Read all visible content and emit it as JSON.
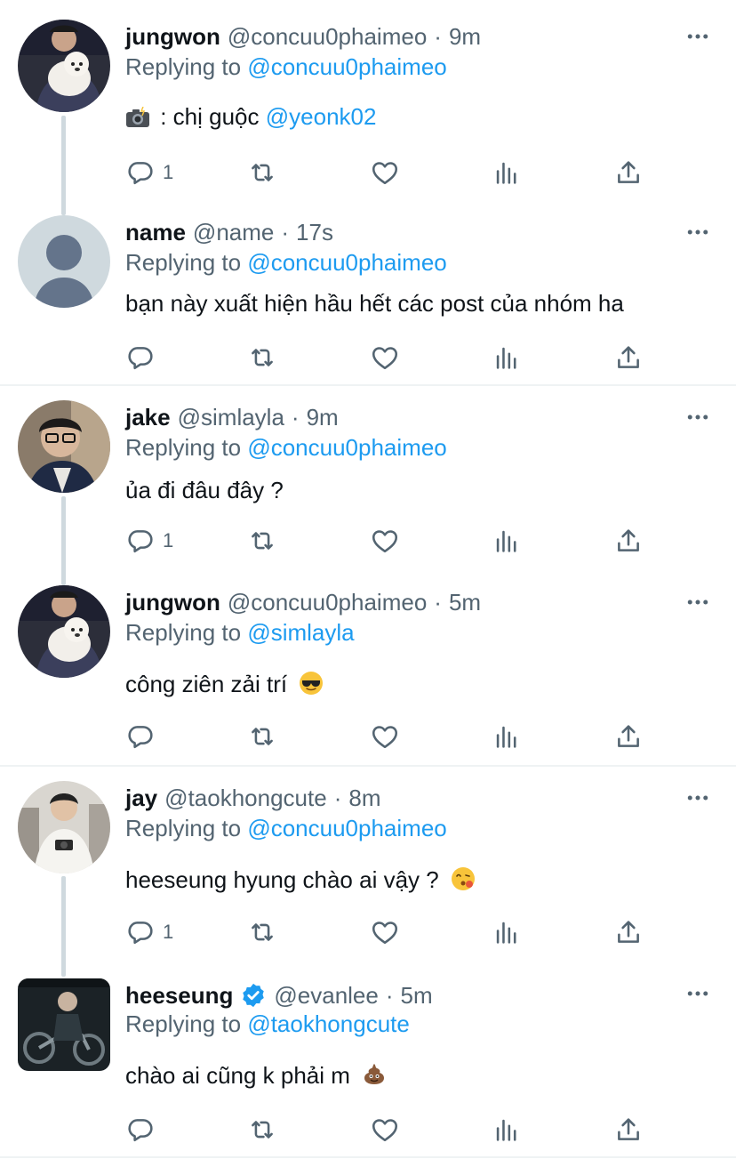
{
  "tweets": [
    {
      "name": "jungwon",
      "handle": "@concuu0phaimeo",
      "time": "9m",
      "reply_label": "Replying to",
      "reply_to": "@concuu0phaimeo",
      "text": ": chị guộc",
      "text_mention": "@yeonk02",
      "text_emoji": "camera-with-flash",
      "reply_count": "1",
      "avatar": "dog-photo"
    },
    {
      "name": "name",
      "handle": "@name",
      "time": "17s",
      "reply_label": "Replying to",
      "reply_to": "@concuu0phaimeo",
      "text": "bạn này xuất hiện hầu hết các post của nhóm ha",
      "reply_count": "",
      "avatar": "default-profile"
    },
    {
      "name": "jake",
      "handle": "@simlayla",
      "time": "9m",
      "reply_label": "Replying to",
      "reply_to": "@concuu0phaimeo",
      "text": "ủa đi đâu đây ?",
      "reply_count": "1",
      "avatar": "jake-photo"
    },
    {
      "name": "jungwon",
      "handle": "@concuu0phaimeo",
      "time": "5m",
      "reply_label": "Replying to",
      "reply_to": "@simlayla",
      "text": "công ziên zải trí",
      "text_emoji": "sunglasses-face",
      "reply_count": "",
      "avatar": "dog-photo"
    },
    {
      "name": "jay",
      "handle": "@taokhongcute",
      "time": "8m",
      "reply_label": "Replying to",
      "reply_to": "@concuu0phaimeo",
      "text": "heeseung hyung chào ai vậy ?",
      "text_emoji": "face-blowing-kiss",
      "reply_count": "1",
      "avatar": "jay-photo"
    },
    {
      "name": "heeseung",
      "handle": "@evanlee",
      "time": "5m",
      "verified": true,
      "reply_label": "Replying to",
      "reply_to": "@taokhongcute",
      "text": "chào ai cũng k phải m",
      "text_emoji": "pile-of-poo",
      "reply_count": "",
      "avatar": "heeseung-photo"
    }
  ],
  "colors": {
    "accent": "#1d9bf0",
    "secondary_text": "#536471",
    "divider": "#eff3f4",
    "thread_line": "#cfd9de"
  }
}
